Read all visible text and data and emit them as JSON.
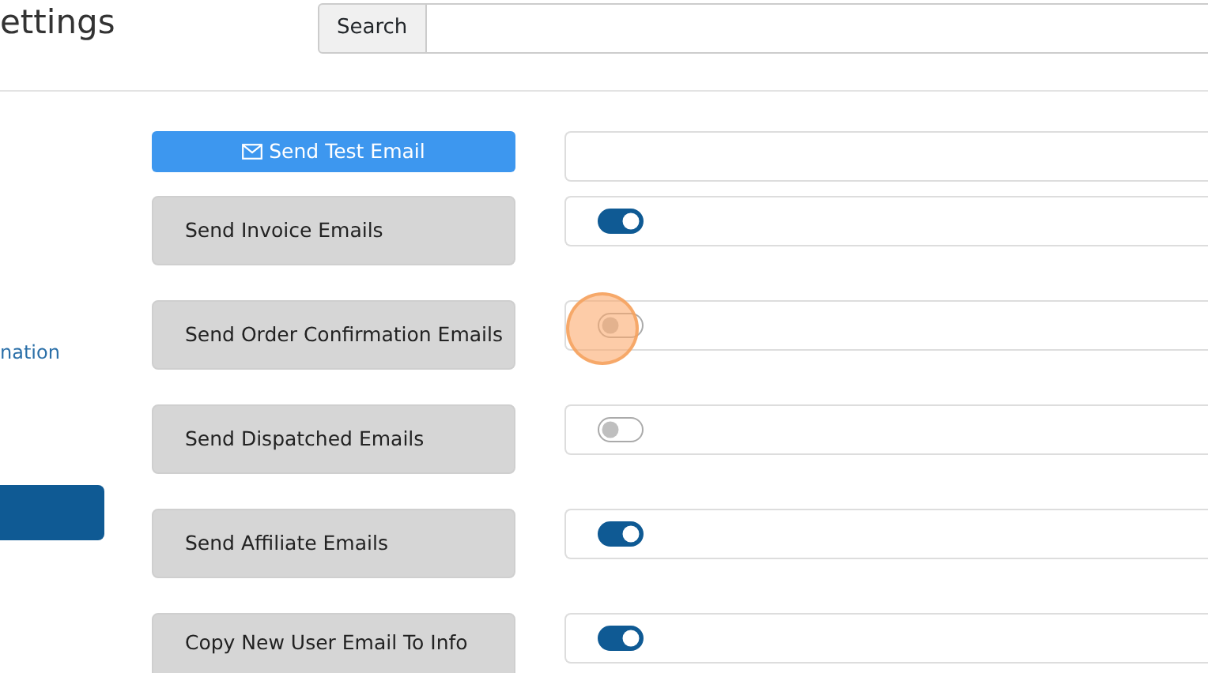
{
  "page_title": "ettings",
  "search": {
    "label": "Search"
  },
  "sidebar": {
    "link": "nation"
  },
  "test_button": {
    "label": "Send Test Email"
  },
  "settings": [
    {
      "label": "Send Invoice Emails",
      "on": true,
      "click_highlight": false
    },
    {
      "label": "Send Order Confirmation Emails",
      "on": false,
      "click_highlight": true
    },
    {
      "label": "Send Dispatched Emails",
      "on": false,
      "click_highlight": false
    },
    {
      "label": "Send Affiliate Emails",
      "on": true,
      "click_highlight": false
    },
    {
      "label": "Copy New User Email To Info",
      "on": true,
      "click_highlight": false
    }
  ]
}
